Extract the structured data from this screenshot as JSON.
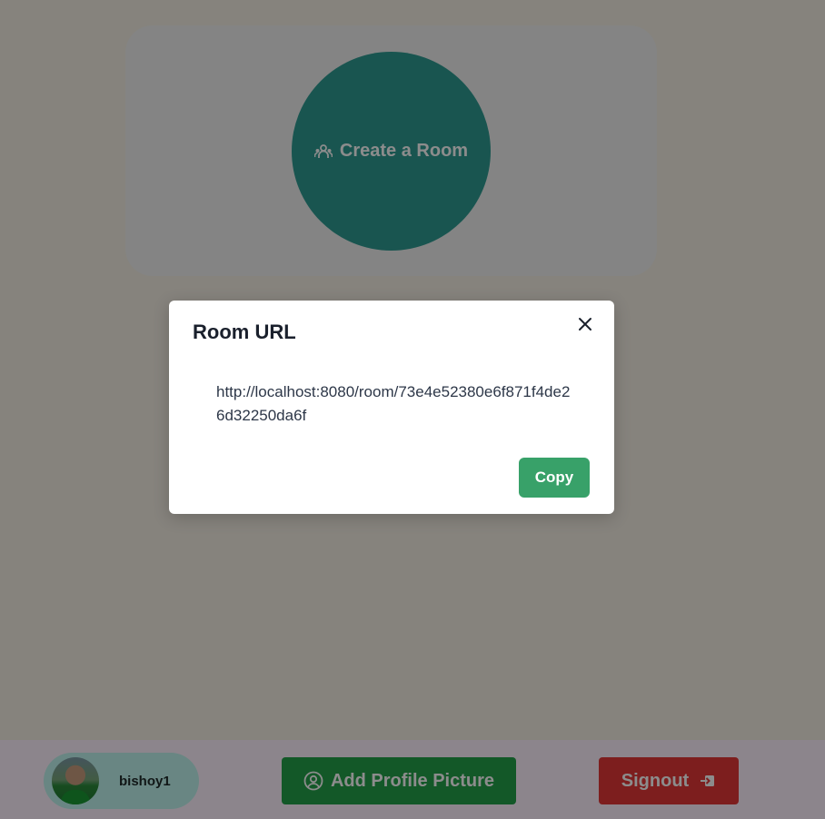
{
  "main": {
    "create_room_label": "Create a Room",
    "create_room_icon": "users-icon"
  },
  "footer": {
    "username": "bishoy1",
    "add_picture_label": "Add Profile Picture",
    "add_picture_icon": "user-circle-icon",
    "signout_label": "Signout",
    "signout_icon": "sign-in-icon"
  },
  "modal": {
    "title": "Room URL",
    "url": "http://localhost:8080/room/73e4e52380e6f871f4de26d32250da6f",
    "copy_label": "Copy",
    "close_icon": "close-icon"
  },
  "colors": {
    "teal": "#2f9c93",
    "green": "#23a04a",
    "red": "#e33838",
    "copy_green": "#38a169",
    "overlay": "rgba(0,0,0,0.45)"
  }
}
